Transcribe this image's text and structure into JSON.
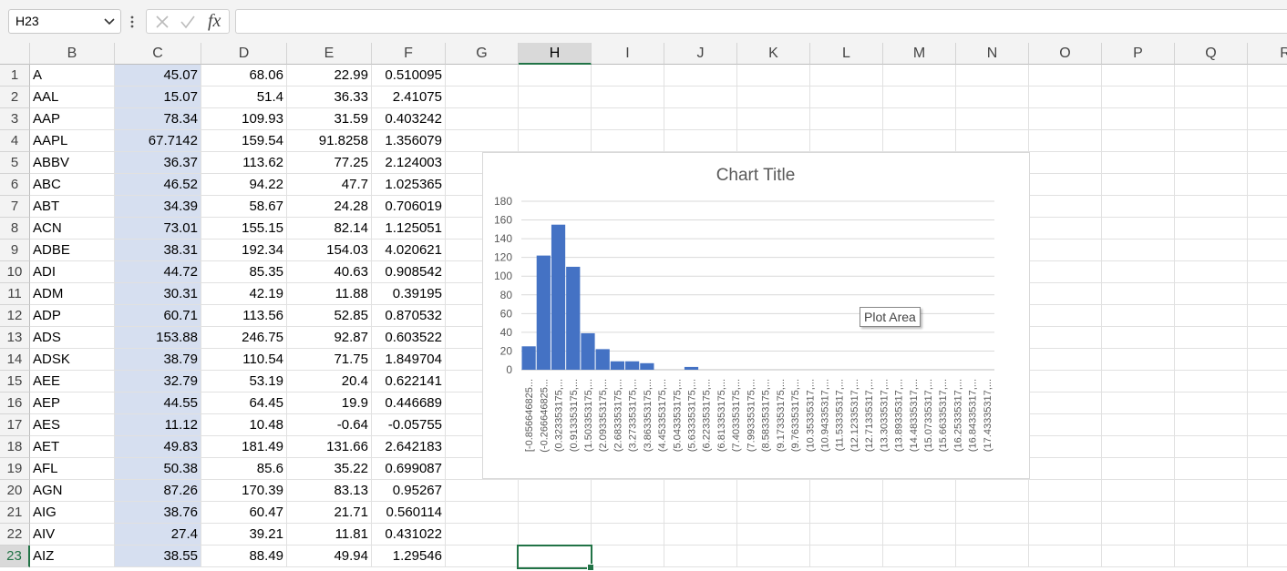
{
  "name_box": {
    "value": "H23"
  },
  "formula_bar": {
    "fx_label": "fx",
    "value": ""
  },
  "columns": [
    "B",
    "C",
    "D",
    "E",
    "F",
    "G",
    "H",
    "I",
    "J",
    "K",
    "L",
    "M",
    "N",
    "O",
    "P",
    "Q",
    "R"
  ],
  "selected_column": "H",
  "selected_row": 23,
  "rows": [
    {
      "n": "1",
      "b": "A",
      "c": "45.07",
      "d": "68.06",
      "e": "22.99",
      "f": "0.510095"
    },
    {
      "n": "2",
      "b": "AAL",
      "c": "15.07",
      "d": "51.4",
      "e": "36.33",
      "f": "2.41075"
    },
    {
      "n": "3",
      "b": "AAP",
      "c": "78.34",
      "d": "109.93",
      "e": "31.59",
      "f": "0.403242"
    },
    {
      "n": "4",
      "b": "AAPL",
      "c": "67.7142",
      "d": "159.54",
      "e": "91.8258",
      "f": "1.356079"
    },
    {
      "n": "5",
      "b": "ABBV",
      "c": "36.37",
      "d": "113.62",
      "e": "77.25",
      "f": "2.124003"
    },
    {
      "n": "6",
      "b": "ABC",
      "c": "46.52",
      "d": "94.22",
      "e": "47.7",
      "f": "1.025365"
    },
    {
      "n": "7",
      "b": "ABT",
      "c": "34.39",
      "d": "58.67",
      "e": "24.28",
      "f": "0.706019"
    },
    {
      "n": "8",
      "b": "ACN",
      "c": "73.01",
      "d": "155.15",
      "e": "82.14",
      "f": "1.125051"
    },
    {
      "n": "9",
      "b": "ADBE",
      "c": "38.31",
      "d": "192.34",
      "e": "154.03",
      "f": "4.020621"
    },
    {
      "n": "10",
      "b": "ADI",
      "c": "44.72",
      "d": "85.35",
      "e": "40.63",
      "f": "0.908542"
    },
    {
      "n": "11",
      "b": "ADM",
      "c": "30.31",
      "d": "42.19",
      "e": "11.88",
      "f": "0.39195"
    },
    {
      "n": "12",
      "b": "ADP",
      "c": "60.71",
      "d": "113.56",
      "e": "52.85",
      "f": "0.870532"
    },
    {
      "n": "13",
      "b": "ADS",
      "c": "153.88",
      "d": "246.75",
      "e": "92.87",
      "f": "0.603522"
    },
    {
      "n": "14",
      "b": "ADSK",
      "c": "38.79",
      "d": "110.54",
      "e": "71.75",
      "f": "1.849704"
    },
    {
      "n": "15",
      "b": "AEE",
      "c": "32.79",
      "d": "53.19",
      "e": "20.4",
      "f": "0.622141"
    },
    {
      "n": "16",
      "b": "AEP",
      "c": "44.55",
      "d": "64.45",
      "e": "19.9",
      "f": "0.446689"
    },
    {
      "n": "17",
      "b": "AES",
      "c": "11.12",
      "d": "10.48",
      "e": "-0.64",
      "f": "-0.05755"
    },
    {
      "n": "18",
      "b": "AET",
      "c": "49.83",
      "d": "181.49",
      "e": "131.66",
      "f": "2.642183"
    },
    {
      "n": "19",
      "b": "AFL",
      "c": "50.38",
      "d": "85.6",
      "e": "35.22",
      "f": "0.699087"
    },
    {
      "n": "20",
      "b": "AGN",
      "c": "87.26",
      "d": "170.39",
      "e": "83.13",
      "f": "0.95267"
    },
    {
      "n": "21",
      "b": "AIG",
      "c": "38.76",
      "d": "60.47",
      "e": "21.71",
      "f": "0.560114"
    },
    {
      "n": "22",
      "b": "AIV",
      "c": "27.4",
      "d": "39.21",
      "e": "11.81",
      "f": "0.431022"
    },
    {
      "n": "23",
      "b": "AIZ",
      "c": "38.55",
      "d": "88.49",
      "e": "49.94",
      "f": "1.29546"
    }
  ],
  "tooltip": "Plot Area",
  "colors": {
    "bar": "#4472c4",
    "highlight": "#d6dff0",
    "accent": "#217346"
  },
  "chart_data": {
    "type": "bar",
    "title": "Chart Title",
    "xlabel": "",
    "ylabel": "",
    "ylim": [
      0,
      180
    ],
    "yticks": [
      0,
      20,
      40,
      60,
      80,
      100,
      120,
      140,
      160,
      180
    ],
    "grid": true,
    "categories": [
      "[-0.856646825...",
      "(-0.266646825...",
      "(0.323353175,...",
      "(0.913353175,...",
      "(1.503353175,...",
      "(2.093353175,...",
      "(2.683353175,...",
      "(3.273353175,...",
      "(3.863353175,...",
      "(4.453353175,...",
      "(5.043353175,...",
      "(5.633353175,...",
      "(6.223353175,...",
      "(6.813353175,...",
      "(7.403353175,...",
      "(7.993353175,...",
      "(8.583353175,...",
      "(9.173353175,...",
      "(9.763353175,...",
      "(10.35335317,...",
      "(10.94335317,...",
      "(11.53335317,...",
      "(12.12335317,...",
      "(12.71335317,...",
      "(13.30335317,...",
      "(13.89335317,...",
      "(14.48335317,...",
      "(15.07335317,...",
      "(15.66335317,...",
      "(16.25335317,...",
      "(16.84335317,...",
      "(17.43335317,..."
    ],
    "values": [
      25,
      122,
      155,
      110,
      39,
      22,
      9,
      9,
      7,
      0,
      0,
      3,
      0,
      0,
      0,
      0,
      0,
      0,
      0,
      0,
      0,
      0,
      0,
      0,
      0,
      0,
      0,
      0,
      0,
      0,
      0,
      0
    ]
  }
}
